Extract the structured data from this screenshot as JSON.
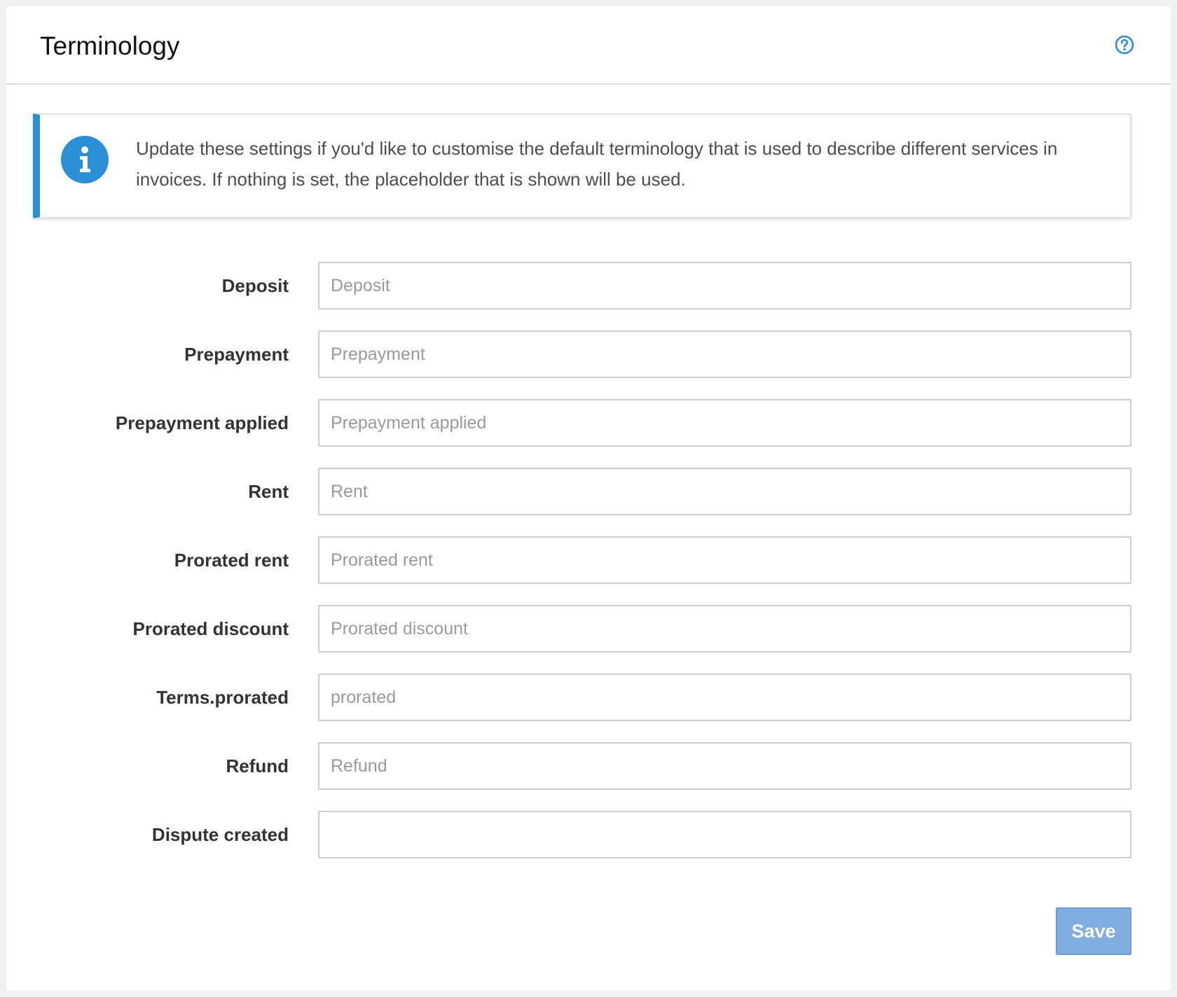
{
  "header": {
    "title": "Terminology",
    "help_icon": "question-circle-icon"
  },
  "info": {
    "icon": "info-circle-icon",
    "text": "Update these settings if you'd like to customise the default terminology that is used to describe different services in invoices. If nothing is set, the placeholder that is shown will be used."
  },
  "fields": [
    {
      "label": "Deposit",
      "placeholder": "Deposit",
      "value": ""
    },
    {
      "label": "Prepayment",
      "placeholder": "Prepayment",
      "value": ""
    },
    {
      "label": "Prepayment applied",
      "placeholder": "Prepayment applied",
      "value": ""
    },
    {
      "label": "Rent",
      "placeholder": "Rent",
      "value": ""
    },
    {
      "label": "Prorated rent",
      "placeholder": "Prorated rent",
      "value": ""
    },
    {
      "label": "Prorated discount",
      "placeholder": "Prorated discount",
      "value": ""
    },
    {
      "label": "Terms.prorated",
      "placeholder": "prorated",
      "value": ""
    },
    {
      "label": "Refund",
      "placeholder": "Refund",
      "value": ""
    },
    {
      "label": "Dispute created",
      "placeholder": "",
      "value": ""
    }
  ],
  "actions": {
    "save_label": "Save"
  },
  "colors": {
    "accent": "#2b8fd6",
    "save_button": "#80aee0",
    "help_icon": "#2b8fd6"
  }
}
